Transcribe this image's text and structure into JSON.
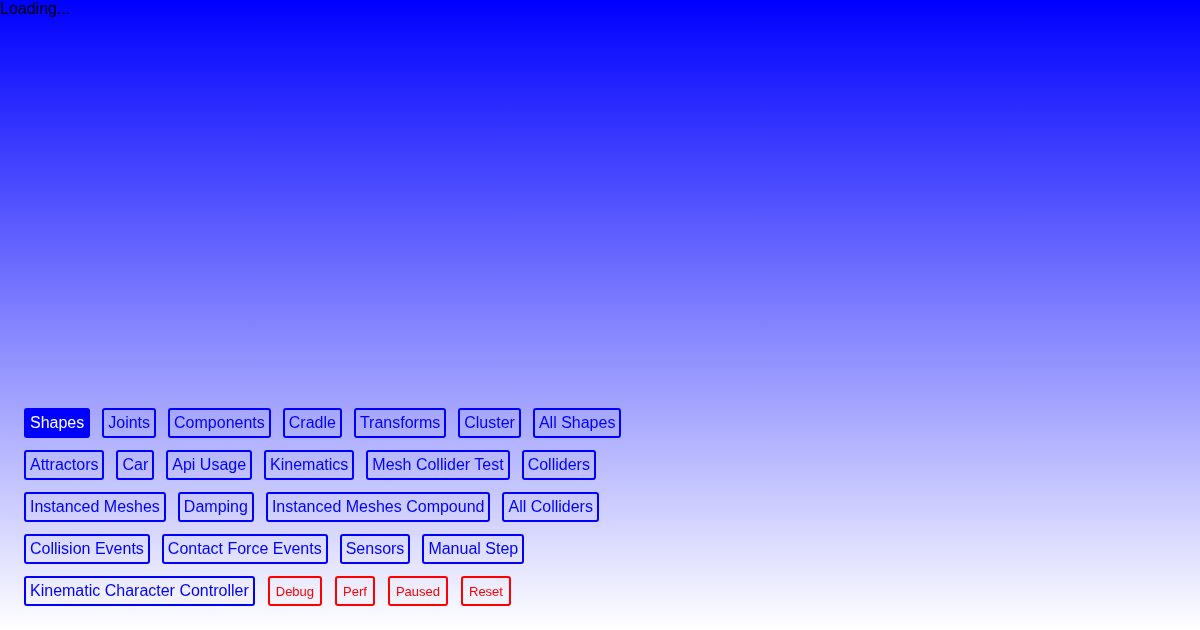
{
  "status_text": "Loading...",
  "demos": [
    {
      "label": "Shapes",
      "selected": true
    },
    {
      "label": "Joints",
      "selected": false
    },
    {
      "label": "Components",
      "selected": false
    },
    {
      "label": "Cradle",
      "selected": false
    },
    {
      "label": "Transforms",
      "selected": false
    },
    {
      "label": "Cluster",
      "selected": false
    },
    {
      "label": "All Shapes",
      "selected": false
    },
    {
      "label": "Attractors",
      "selected": false
    },
    {
      "label": "Car",
      "selected": false
    },
    {
      "label": "Api Usage",
      "selected": false
    },
    {
      "label": "Kinematics",
      "selected": false
    },
    {
      "label": "Mesh Collider Test",
      "selected": false
    },
    {
      "label": "Colliders",
      "selected": false
    },
    {
      "label": "Instanced Meshes",
      "selected": false
    },
    {
      "label": "Damping",
      "selected": false
    },
    {
      "label": "Instanced Meshes Compound",
      "selected": false
    },
    {
      "label": "All Colliders",
      "selected": false
    },
    {
      "label": "Collision Events",
      "selected": false
    },
    {
      "label": "Contact Force Events",
      "selected": false
    },
    {
      "label": "Sensors",
      "selected": false
    },
    {
      "label": "Manual Step",
      "selected": false
    },
    {
      "label": "Kinematic Character Controller",
      "selected": false
    }
  ],
  "controls": [
    {
      "label": "Debug"
    },
    {
      "label": "Perf"
    },
    {
      "label": "Paused"
    },
    {
      "label": "Reset"
    }
  ]
}
